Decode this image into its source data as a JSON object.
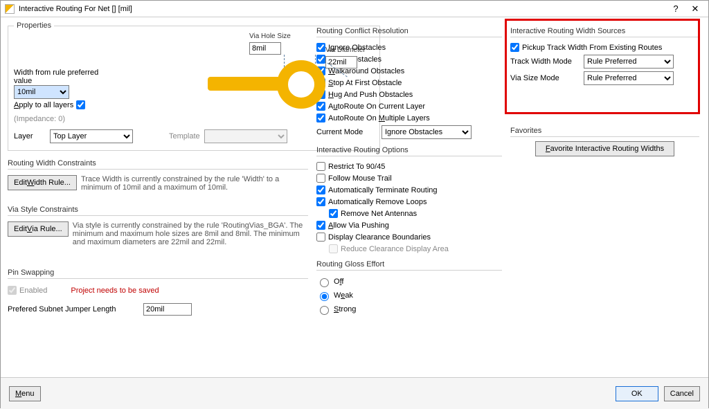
{
  "title": "Interactive Routing For Net [] [mil]",
  "properties": {
    "legend": "Properties",
    "widthFromRuleLabel": "Width from rule preferred value",
    "widthFromRuleValue": "10mil",
    "applyAllLayers": "Apply to all layers",
    "impedance": "(Impedance: 0)",
    "layerLabel": "Layer",
    "layerValue": "Top Layer",
    "templateLabel": "Template",
    "templateValue": "",
    "viaHoleSizeLabel": "Via Hole Size",
    "viaHoleSizeValue": "8mil",
    "viaDiameterLabel": "Via Diameter",
    "viaDiameterValue": "22mil"
  },
  "widthConstraints": {
    "hdr": "Routing Width Constraints",
    "btn": "Edit Width Rule...",
    "text": "Trace Width is currently constrained by the rule 'Width' to a minimum of 10mil and a maximum of 10mil."
  },
  "viaConstraints": {
    "hdr": "Via Style Constraints",
    "btn": "Edit Via Rule...",
    "text": "Via style is currently constrained by the rule 'RoutingVias_BGA'. The minimum and maximum hole sizes are 8mil and 8mil. The minimum and maximum diameters are 22mil and 22mil."
  },
  "pinSwap": {
    "hdr": "Pin Swapping",
    "enabled": "Enabled",
    "warn": "Project needs to be saved",
    "jumperLabel": "Prefered Subnet Jumper Length",
    "jumperValue": "20mil"
  },
  "conflict": {
    "hdr": "Routing Conflict Resolution",
    "items": [
      "Ignore Obstacles",
      "Push Obstacles",
      "Walkaround Obstacles",
      "Stop At First Obstacle",
      "Hug And Push Obstacles",
      "AutoRoute On Current Layer",
      "AutoRoute On Multiple Layers"
    ],
    "currentModeLabel": "Current Mode",
    "currentModeValue": "Ignore Obstacles"
  },
  "options": {
    "hdr": "Interactive Routing Options",
    "restrict": "Restrict To 90/45",
    "follow": "Follow Mouse Trail",
    "autoTerm": "Automatically Terminate Routing",
    "autoLoop": "Automatically Remove Loops",
    "removeAnt": "Remove Net Antennas",
    "allowVia": "Allow Via Pushing",
    "dispClear": "Display Clearance Boundaries",
    "reduceClear": "Reduce Clearance Display Area"
  },
  "gloss": {
    "hdr": "Routing Gloss Effort",
    "off": "Off",
    "weak": "Weak",
    "strong": "Strong"
  },
  "widthSources": {
    "hdr": "Interactive Routing Width Sources",
    "pickup": "Pickup Track Width From Existing Routes",
    "trackLabel": "Track Width Mode",
    "trackValue": "Rule Preferred",
    "viaLabel": "Via Size Mode",
    "viaValue": "Rule Preferred"
  },
  "favorites": {
    "hdr": "Favorites",
    "btn": "Favorite Interactive Routing Widths"
  },
  "footer": {
    "menu": "Menu",
    "ok": "OK",
    "cancel": "Cancel"
  }
}
